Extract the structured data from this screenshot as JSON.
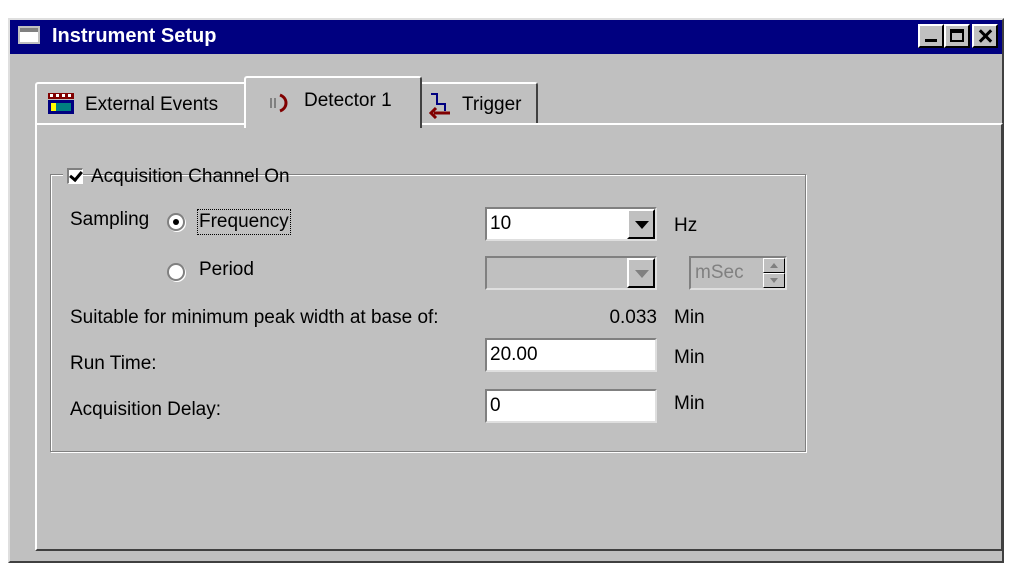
{
  "window": {
    "title": "Instrument Setup"
  },
  "tabs": [
    {
      "label": "External Events",
      "icon": "event-grid-icon"
    },
    {
      "label": "Detector 1",
      "icon": "detector-signal-icon"
    },
    {
      "label": "Trigger",
      "icon": "trigger-arrow-icon"
    }
  ],
  "active_tab": "Detector 1",
  "group": {
    "label": "Acquisition Channel On",
    "checked": true
  },
  "sampling": {
    "label": "Sampling",
    "options": [
      "Frequency",
      "Period"
    ],
    "selected": "Frequency",
    "frequency_value": "10",
    "frequency_unit": "Hz",
    "period_value": "",
    "period_unit": "mSec"
  },
  "peak_width": {
    "label": "Suitable for minimum peak width at base of:",
    "value": "0.033",
    "unit": "Min"
  },
  "run_time": {
    "label": "Run Time:",
    "value": "20.00",
    "unit": "Min"
  },
  "acquisition_delay": {
    "label": "Acquisition Delay:",
    "value": "0",
    "unit": "Min"
  },
  "colors": {
    "titlebar": "#000080",
    "face": "#c0c0c0"
  }
}
